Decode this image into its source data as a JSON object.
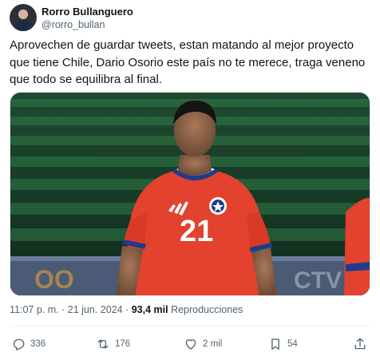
{
  "author": {
    "name": "Rorro Bullanguero",
    "handle": "@rorro_bullan"
  },
  "tweet": {
    "text": "Aprovechen de guardar tweets, estan matando al mejor proyecto que tiene Chile, Dario Osorio este país no te merece, traga veneno que todo se equilibra al final."
  },
  "media": {
    "jersey_number": "21",
    "jersey_color": "#e2422e",
    "stadium_seat_color": "#2f7a45"
  },
  "meta": {
    "time": "11:07 p. m.",
    "separator": "·",
    "date": "21 jun. 2024",
    "views_count": "93,4 mil",
    "views_label": "Reproducciones"
  },
  "actions": {
    "replies": "336",
    "reposts": "176",
    "likes": "2 mil",
    "bookmarks": "54"
  },
  "icons": [
    "reply-icon",
    "repost-icon",
    "like-icon",
    "bookmark-icon",
    "share-icon"
  ],
  "colors": {
    "text_primary": "#0f1419",
    "text_secondary": "#536471"
  }
}
